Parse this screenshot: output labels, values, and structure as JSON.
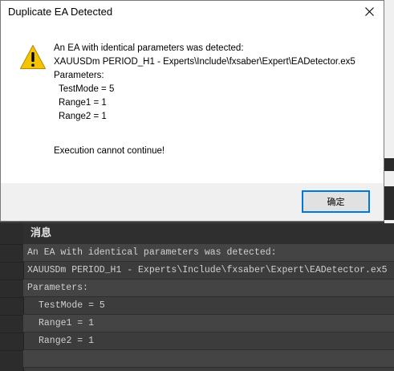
{
  "dialog": {
    "title": "Duplicate EA Detected",
    "lines": [
      "An EA with identical parameters was detected:",
      "XAUUSDm PERIOD_H1 - Experts\\Include\\fxsaber\\Expert\\EADetector.ex5",
      "Parameters:",
      "TestMode = 5",
      "Range1 = 1",
      "Range2 = 1"
    ],
    "footer_message": "Execution cannot continue!",
    "ok_label": "确定"
  },
  "log_panel": {
    "header": "消息",
    "rows": [
      "An EA with identical parameters was detected:",
      "XAUUSDm PERIOD_H1 - Experts\\Include\\fxsaber\\Expert\\EADetector.ex5",
      "Parameters:",
      "TestMode = 5",
      "Range1 = 1",
      "Range2 = 1"
    ]
  },
  "colors": {
    "accent": "#0078d7",
    "warning": "#f5c400"
  }
}
